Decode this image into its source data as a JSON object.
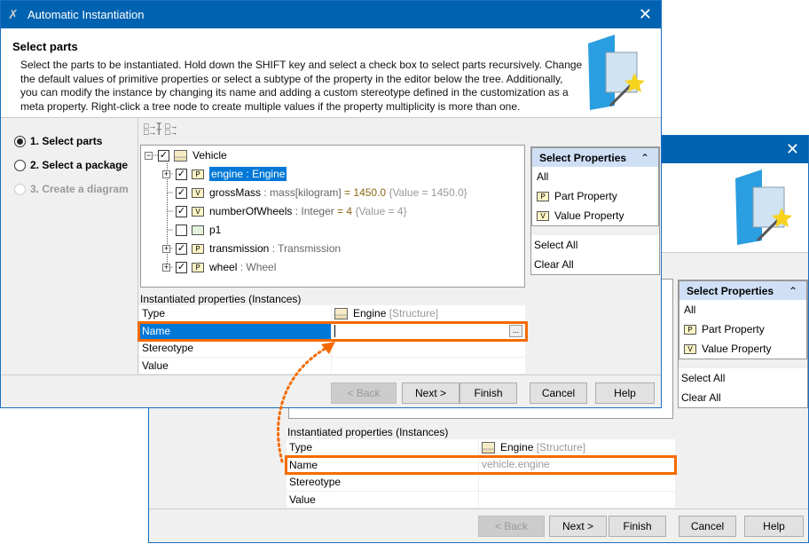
{
  "title": "Automatic Instantiation",
  "header": {
    "heading": "Select parts",
    "description_lines": [
      "Select the parts to be instantiated. Hold down the SHIFT key and select a check box to select parts recursively. Change",
      "the default values of primitive properties or select a subtype of the property in the editor below the tree. Additionally,",
      "you can modify the instance by changing its name and adding a custom stereotype defined in the customization as a",
      "meta property. Right-click a tree node to create multiple values if the property multiplicity is more than one."
    ]
  },
  "steps": [
    "1. Select parts",
    "2. Select a package",
    "3. Create a diagram"
  ],
  "tree": {
    "root": "Vehicle",
    "items": [
      {
        "name": "engine",
        "sep": " : ",
        "type": "Engine",
        "extra": "",
        "icon": "P",
        "checked": true
      },
      {
        "name": "grossMass",
        "sep": " : ",
        "type": "mass[kilogram]",
        "val": " = 1450.0 ",
        "extra": "{Value = 1450.0}",
        "icon": "V",
        "checked": true
      },
      {
        "name": "numberOfWheels",
        "sep": " : ",
        "type": "Integer",
        "val": " = 4 ",
        "extra": "{Value = 4}",
        "icon": "V",
        "checked": true
      },
      {
        "name": "p1",
        "icon": "port",
        "checked": false
      },
      {
        "name": "transmission",
        "sep": " : ",
        "type": "Transmission",
        "icon": "P",
        "checked": true
      },
      {
        "name": "wheel",
        "sep": " : ",
        "type": "Wheel",
        "icon": "P",
        "checked": true
      }
    ]
  },
  "select_properties": {
    "title": "Select Properties",
    "items": [
      "All",
      "Part Property",
      "Value Property"
    ],
    "actions": [
      "Select All",
      "Clear All"
    ]
  },
  "instances": {
    "label": "Instantiated properties (Instances)",
    "rows": [
      "Type",
      "Name",
      "Stereotype",
      "Value"
    ],
    "type_value": "Engine",
    "type_kind": "[Structure]",
    "name_value_front": "",
    "name_value_back": "vehicle.engine",
    "ellipsis": "..."
  },
  "buttons": {
    "back": "< Back",
    "next": "Next >",
    "finish": "Finish",
    "cancel": "Cancel",
    "help": "Help"
  },
  "accent": "#f56a00"
}
